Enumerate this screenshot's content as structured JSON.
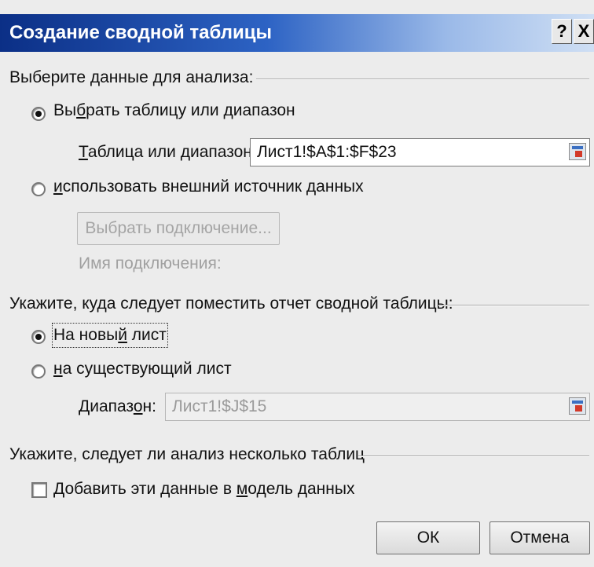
{
  "dialog": {
    "title": "Создание сводной таблицы",
    "help_label": "?",
    "close_label": "X"
  },
  "section_data": {
    "label": "Выберите данные для анализа:",
    "option_table": {
      "label_pre": "Вы",
      "label_ul": "б",
      "label_post": "рать таблицу или диапазон",
      "checked": true
    },
    "range_label_ul": "Т",
    "range_label_post": "аблица или диапазон:",
    "range_value": "Лист1!$A$1:$F$23",
    "option_external": {
      "label_ul": "и",
      "label_post": "спользовать внешний источник данных",
      "checked": false
    },
    "choose_connection_label": "Выбрать подключение...",
    "connection_name_label": "Имя подключения:"
  },
  "section_location": {
    "label": "Укажите, куда следует поместить отчет сводной таблицы:",
    "option_new": {
      "label_pre": "На новы",
      "label_ul": "й",
      "label_post": " лист",
      "checked": true
    },
    "option_existing": {
      "label_ul": "н",
      "label_post": "а существующий лист",
      "checked": false
    },
    "range_label_pre": "Диапаз",
    "range_label_ul": "о",
    "range_label_post": "н:",
    "range_value": "Лист1!$J$15"
  },
  "section_multi": {
    "label": "Укажите, следует ли анализ несколько таблиц",
    "checkbox": {
      "label_pre": "Добавить эти данные в ",
      "label_ul": "м",
      "label_post": "одель данных",
      "checked": false
    }
  },
  "buttons": {
    "ok": "ОК",
    "cancel": "Отмена"
  }
}
